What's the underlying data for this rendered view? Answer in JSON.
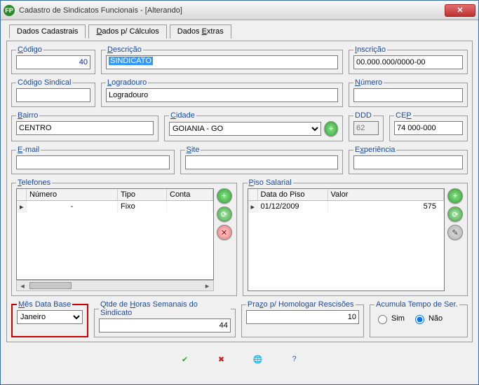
{
  "window": {
    "title": "Cadastro de Sindicatos Funcionais - [Alterando]"
  },
  "tabs": {
    "t1": "Dados Cadastrais",
    "t2a": "D",
    "t2b": "ados p/ Cálculos",
    "t3a": "Dados ",
    "t3b": "E",
    "t3c": "xtras"
  },
  "groups": {
    "codigo": {
      "label_u": "C",
      "label_rest": "ódigo",
      "value": "40"
    },
    "descricao": {
      "label_u": "D",
      "label_rest": "escrição",
      "value": "SINDICATO"
    },
    "inscricao": {
      "label_u": "I",
      "label_rest": "nscrição",
      "value": "00.000.000/0000-00"
    },
    "codigo_sindical": {
      "label": "Código Sindical",
      "value": ""
    },
    "logradouro": {
      "label_u": "L",
      "label_rest": "ogradouro",
      "value": "Logradouro"
    },
    "numero": {
      "label_u": "N",
      "label_rest": "úmero",
      "value": ""
    },
    "bairro": {
      "label_u": "B",
      "label_rest": "airro",
      "value": "CENTRO"
    },
    "cidade": {
      "label_u": "C",
      "label_rest": "idade",
      "value": "GOIANIA - GO"
    },
    "ddd": {
      "label": "DDD",
      "value": "62"
    },
    "cep": {
      "label_pre": "CE",
      "label_u": "P",
      "value": "74 000-000"
    },
    "email": {
      "label_u": "E",
      "label_rest": "-mail",
      "value": ""
    },
    "site": {
      "label_u": "S",
      "label_rest": "ite",
      "value": ""
    },
    "experiencia": {
      "label_pre": "E",
      "label_u": "x",
      "label_rest": "periência",
      "value": ""
    },
    "telefones": {
      "label_u": "T",
      "label_rest": "elefones",
      "headers": {
        "numero": "Número",
        "tipo": "Tipo",
        "contato": "Conta"
      },
      "row": {
        "numero": "-",
        "tipo": "Fixo",
        "contato": ""
      }
    },
    "piso": {
      "label_u": "P",
      "label_rest": "iso Salarial",
      "headers": {
        "data": "Data do Piso",
        "valor": "Valor"
      },
      "row": {
        "data": "01/12/2009",
        "valor": "575"
      }
    },
    "mes_data_base": {
      "label_u": "M",
      "label_rest": "ês Data Base",
      "value": "Janeiro"
    },
    "qtde_horas": {
      "label_pre": "Qtde de ",
      "label_u": "H",
      "label_rest": "oras Semanais do Sindicato",
      "value": "44"
    },
    "prazo": {
      "label_pre": "Pra",
      "label_u": "z",
      "label_rest": "o p/ Homologar Rescisões",
      "value": "10"
    },
    "acumula": {
      "label": "Acumula Tempo de Ser.",
      "sim": "Sim",
      "nao": "Não"
    }
  },
  "icons": {
    "plus": "+",
    "reload": "⟳",
    "del": "✕",
    "edit": "✎"
  },
  "buttons": {
    "ok": "✔",
    "cancel": "✖",
    "find": "🌐",
    "help": "?"
  }
}
